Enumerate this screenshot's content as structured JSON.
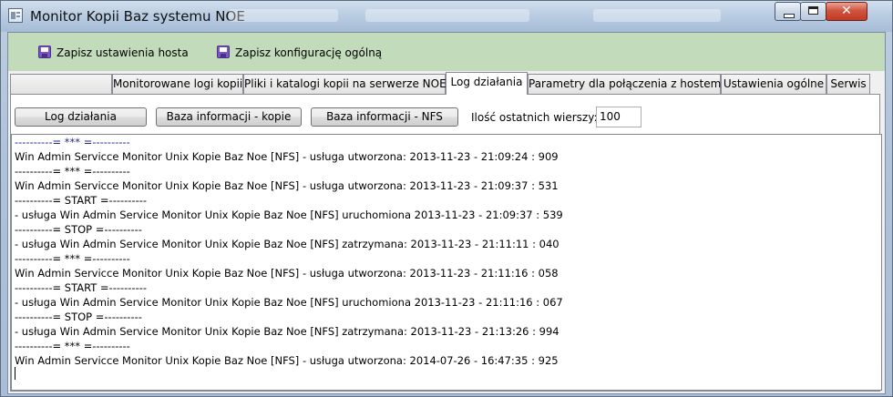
{
  "window": {
    "title": "Monitor Kopii Baz systemu NOE",
    "controls": {
      "minimize": "minimize",
      "maximize": "maximize",
      "close": "✕"
    }
  },
  "toolbar": {
    "save_host": "Zapisz ustawienia hosta",
    "save_general": "Zapisz konfigurację ogólną"
  },
  "tabs": [
    {
      "label": ""
    },
    {
      "label": "Monitorowane logi kopii"
    },
    {
      "label": "Pliki i katalogi kopii na serwerze NOE"
    },
    {
      "label": "Log działania",
      "active": true
    },
    {
      "label": "Parametry dla połączenia z hostem"
    },
    {
      "label": "Ustawienia ogólne"
    },
    {
      "label": "Serwis"
    }
  ],
  "controls": {
    "btn_log": "Log działania",
    "btn_copies": "Baza informacji - kopie",
    "btn_nfs": "Baza informacji - NFS",
    "rows_label": "Ilość ostatnich wierszy:",
    "rows_value": "100"
  },
  "log": [
    "----------= *** =----------",
    "Win Admin Servicce Monitor Unix Kopie Baz Noe [NFS] - usługa utworzona: 2013-11-23 - 21:09:24 : 909",
    "----------= *** =----------",
    "Win Admin Servicce Monitor Unix Kopie Baz Noe [NFS] - usługa utworzona: 2013-11-23 - 21:09:37 : 531",
    "----------= START =----------",
    "- usługa Win Admin Service Monitor Unix Kopie Baz Noe [NFS] uruchomiona 2013-11-23 - 21:09:37 : 539",
    "----------= STOP =----------",
    "- usługa Win Admin Service Monitor Unix Kopie Baz Noe [NFS] zatrzymana: 2013-11-23 - 21:11:11 : 040",
    "----------= *** =----------",
    "Win Admin Servicce Monitor Unix Kopie Baz Noe [NFS] - usługa utworzona: 2013-11-23 - 21:11:16 : 058",
    "----------= START =----------",
    "- usługa Win Admin Service Monitor Unix Kopie Baz Noe [NFS] uruchomiona 2013-11-23 - 21:11:16 : 067",
    "----------= STOP =----------",
    "- usługa Win Admin Service Monitor Unix Kopie Baz Noe [NFS] zatrzymana: 2013-11-23 - 21:13:26 : 994",
    "----------= *** =----------",
    "Win Admin Servicce Monitor Unix Kopie Baz Noe [NFS] - usługa utworzona: 2014-07-26 - 16:47:35 : 925"
  ]
}
